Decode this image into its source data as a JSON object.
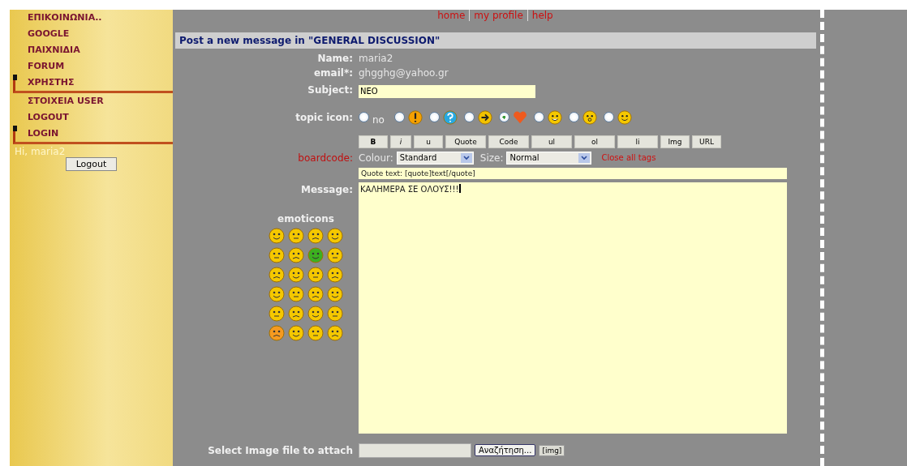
{
  "sidebar": {
    "items": [
      {
        "label": "ΕΠΙΚΟΙΝΩΝΙΑ..",
        "kind": "link"
      },
      {
        "label": "GOOGLE",
        "kind": "link"
      },
      {
        "label": "ΠΑΙΧΝΙΔΙΑ",
        "kind": "link"
      },
      {
        "label": "FORUM",
        "kind": "link"
      },
      {
        "label": "ΧΡΗΣΤΗΣ",
        "kind": "section"
      },
      {
        "label": "ΣΤΟΙΧΕΙΑ USER",
        "kind": "link"
      },
      {
        "label": "LOGOUT",
        "kind": "link"
      },
      {
        "label": "LOGIN",
        "kind": "section"
      }
    ],
    "greeting": "Hi, maria2",
    "logout_button": "Logout"
  },
  "top_nav": [
    "home",
    "my profile",
    "help"
  ],
  "heading": "Post a new message in \"GENERAL DISCUSSION\"",
  "form": {
    "name": {
      "label": "Name:",
      "value": "maria2"
    },
    "email": {
      "label": "email*:",
      "value": "ghgghg@yahoo.gr"
    },
    "subject": {
      "label": "Subject:",
      "value": "NEO"
    },
    "topic_icon": {
      "label": "topic icon:",
      "options": [
        {
          "label": "no",
          "selected": false
        },
        {
          "selected": false
        },
        {
          "selected": false
        },
        {
          "selected": false
        },
        {
          "selected": true
        },
        {
          "selected": false
        },
        {
          "selected": false
        },
        {
          "selected": false
        }
      ]
    },
    "format_buttons": [
      "B",
      "i",
      "u",
      "Quote",
      "Code",
      "ul",
      "ol",
      "li",
      "Img",
      "URL"
    ],
    "boardcode": {
      "label": "boardcode:",
      "colour_label": "Colour:",
      "colour_value": "Standard",
      "size_label": "Size:",
      "size_value": "Normal",
      "close_tags": "Close all tags"
    },
    "hint": "Quote text: [quote]text[/quote]",
    "message": {
      "label": "Message:",
      "value": "ΚΑΛΗΜΕΡΑ ΣΕ ΟΛΟΥΣ!!!"
    },
    "emoticons_label": "emoticons",
    "attach": {
      "label": "Select Image file to attach",
      "browse_button": "Αναζήτηση...",
      "img_button": "[img]"
    }
  }
}
